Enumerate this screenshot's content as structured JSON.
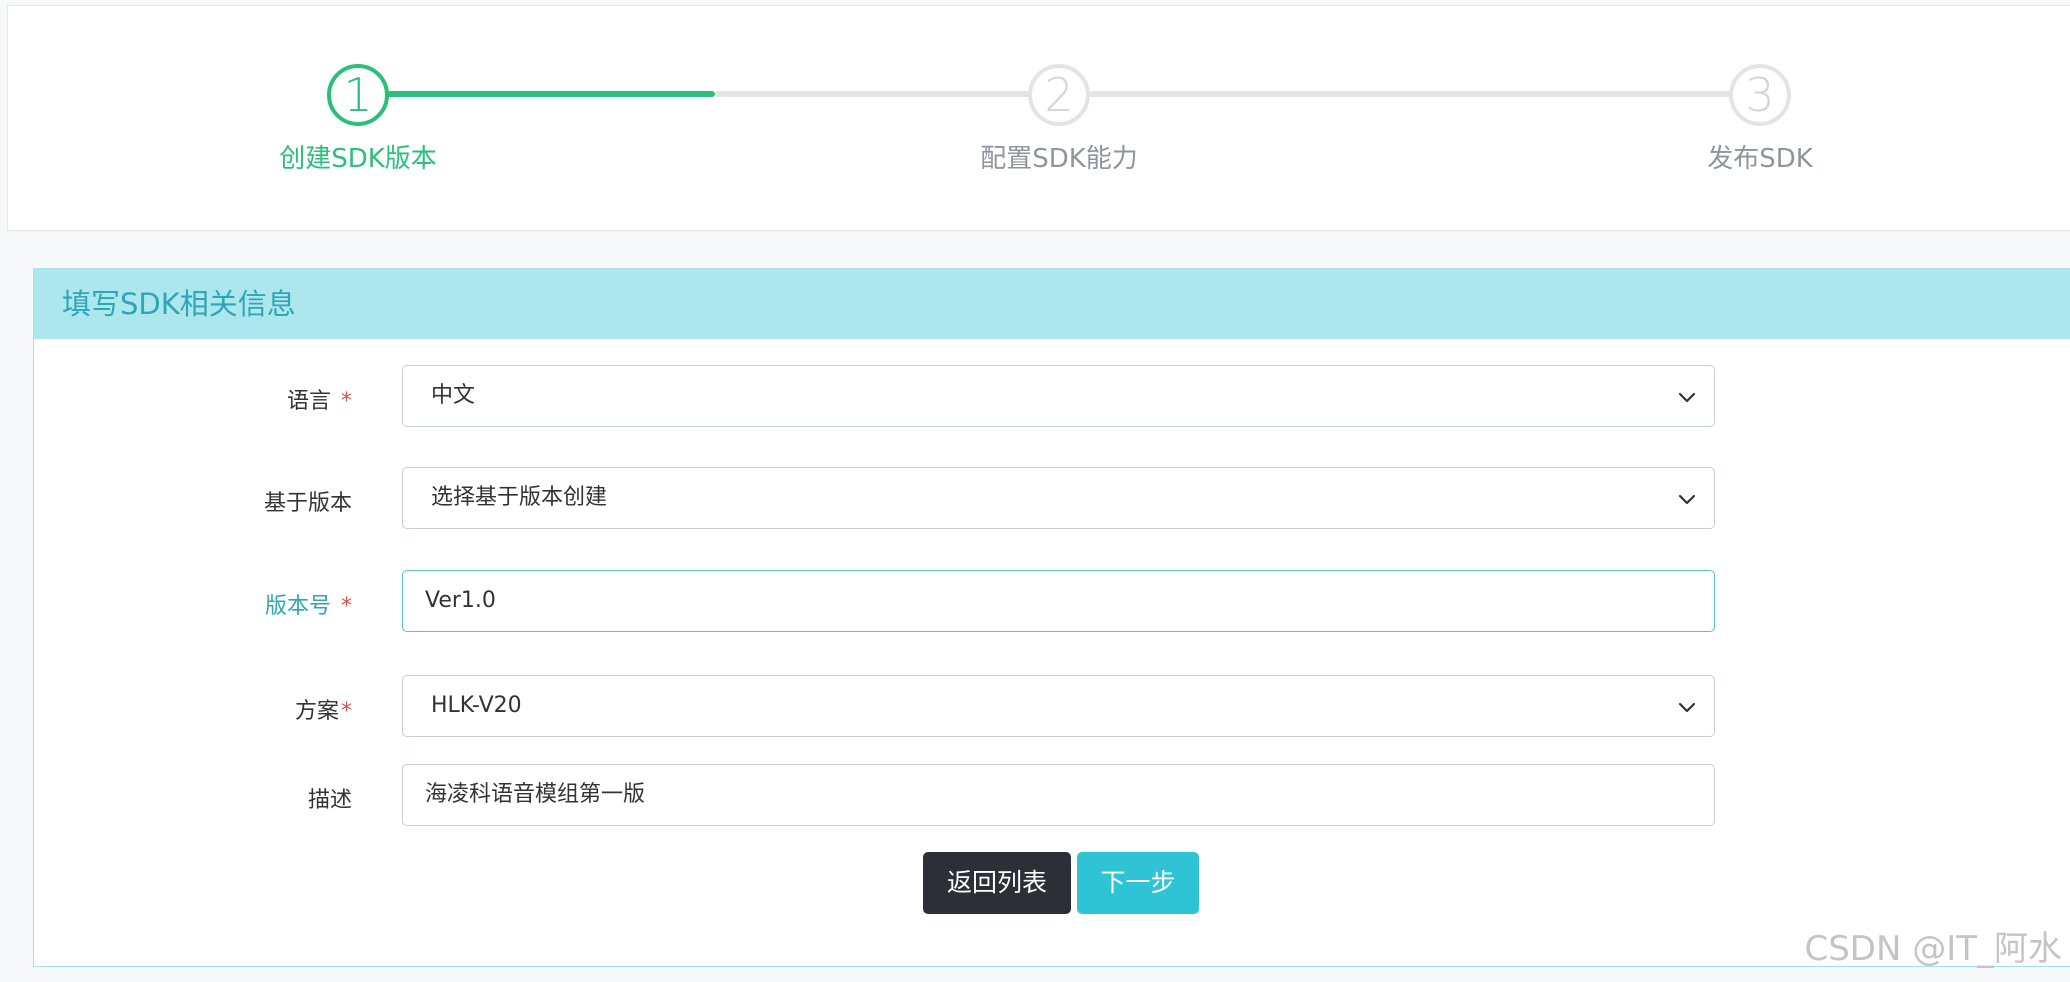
{
  "steps": [
    {
      "number": "1",
      "label": "创建SDK版本",
      "active": true
    },
    {
      "number": "2",
      "label": "配置SDK能力",
      "active": false
    },
    {
      "number": "3",
      "label": "发布SDK",
      "active": false
    }
  ],
  "colors": {
    "active_step": "#2ac07a",
    "panel_heading_bg": "#ade7ee",
    "panel_heading_text": "#2fa5b5",
    "required": "#d9534f",
    "btn_dark": "#2c3036",
    "btn_info": "#2fc3d6"
  },
  "form": {
    "heading": "填写SDK相关信息",
    "language": {
      "label": "语言",
      "required_mark": "*",
      "value": "中文"
    },
    "base_version": {
      "label": "基于版本",
      "value": "选择基于版本创建"
    },
    "version_no": {
      "label": "版本号",
      "required_mark": "*",
      "value": "Ver1.0"
    },
    "scheme": {
      "label": "方案",
      "required_mark": "*",
      "value": "HLK-V20"
    },
    "description": {
      "label": "描述",
      "value": "海凌科语音模组第一版"
    }
  },
  "buttons": {
    "back": "返回列表",
    "next": "下一步"
  },
  "watermark": "CSDN @IT_阿水"
}
